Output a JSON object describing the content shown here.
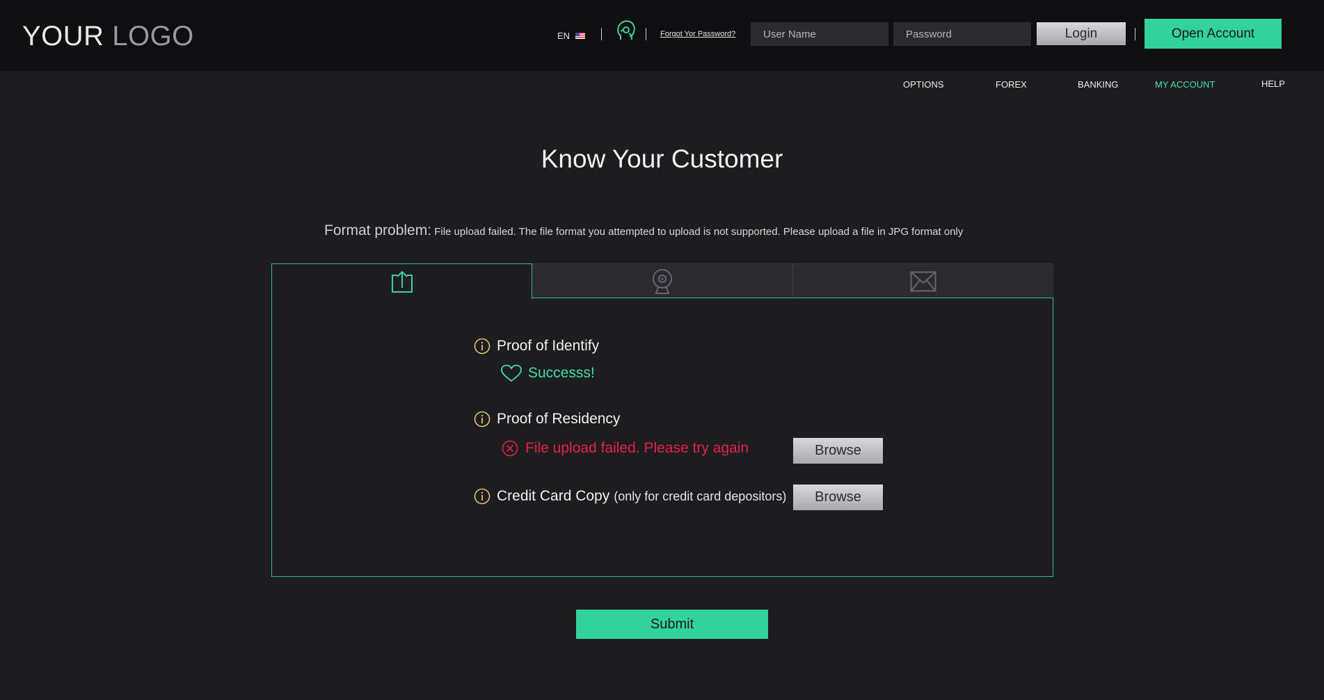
{
  "header": {
    "logo_main": "YOUR",
    "logo_light": "LOGO",
    "language": "EN",
    "forgot_password": "Forgot Yor Password?",
    "username_placeholder": "User Name",
    "password_placeholder": "Password",
    "login_label": "Login",
    "open_account_label": "Open Account"
  },
  "nav": {
    "items": [
      {
        "label": "OPTIONS"
      },
      {
        "label": "FOREX"
      },
      {
        "label": "BANKING"
      },
      {
        "label": "MY ACCOUNT",
        "active": true
      },
      {
        "label": "HELP"
      }
    ]
  },
  "main": {
    "title": "Know Your Customer",
    "format_title": "Format problem:",
    "format_message": " File upload failed. The file format you attempted to upload is not supported. Please upload a file in JPG format only"
  },
  "tabs": [
    {
      "icon": "upload-icon",
      "active": true
    },
    {
      "icon": "webcam-icon",
      "active": false
    },
    {
      "icon": "mail-icon",
      "active": false
    }
  ],
  "items": [
    {
      "label": "Proof of Identify",
      "status": "Successs!",
      "status_type": "success"
    },
    {
      "label": "Proof of Residency",
      "status": "File upload failed. Please try again",
      "status_type": "error",
      "browse_label": "Browse"
    },
    {
      "label": "Credit Card Copy",
      "note": "(only for credit card depositors)",
      "browse_label": "Browse"
    }
  ],
  "submit_label": "Submit",
  "colors": {
    "accent": "#32d29a",
    "error": "#e4234a",
    "info_icon": "#e6c46a",
    "background": "#1c1c21",
    "header_bg": "#0f0f11"
  }
}
